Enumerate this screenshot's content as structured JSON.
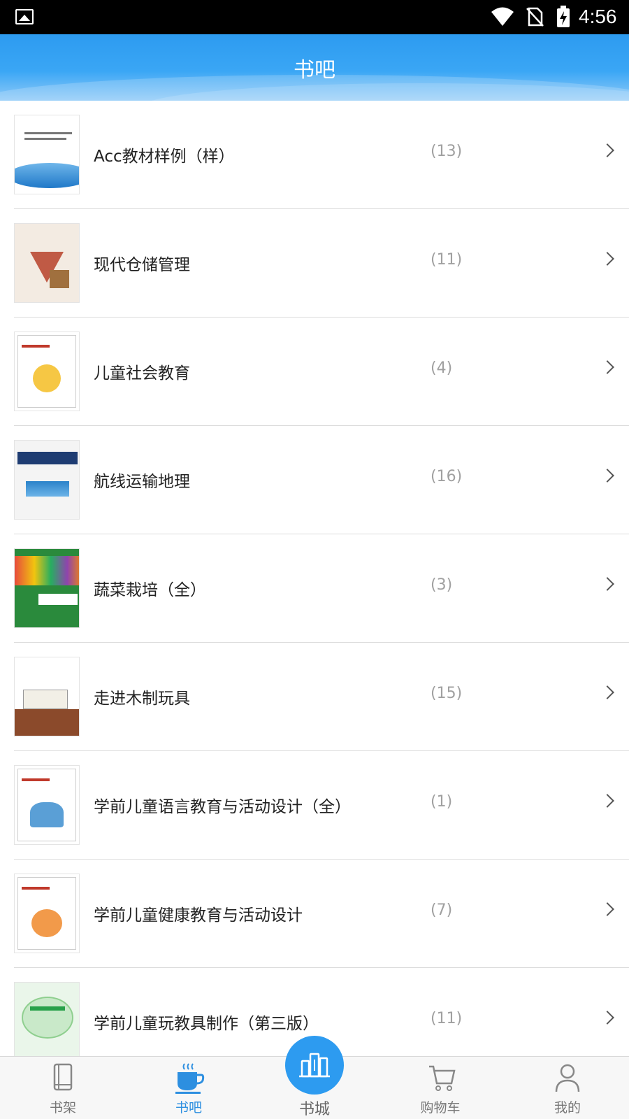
{
  "status_bar": {
    "time": "4:56",
    "icons": [
      "image-icon",
      "wifi-icon",
      "no-sim-icon",
      "battery-charging-icon"
    ]
  },
  "header": {
    "title": "书吧"
  },
  "books": [
    {
      "title": "Acc教材样例（样）",
      "count": "(13)"
    },
    {
      "title": "现代仓储管理",
      "count": "(11)"
    },
    {
      "title": "儿童社会教育",
      "count": "(4)"
    },
    {
      "title": "航线运输地理",
      "count": "(16)"
    },
    {
      "title": "蔬菜栽培（全）",
      "count": "(3)"
    },
    {
      "title": "走进木制玩具",
      "count": "(15)"
    },
    {
      "title": "学前儿童语言教育与活动设计（全）",
      "count": "(1)"
    },
    {
      "title": "学前儿童健康教育与活动设计",
      "count": "(7)"
    },
    {
      "title": "学前儿童玩教具制作（第三版）",
      "count": "(11)"
    }
  ],
  "tabbar": {
    "tabs": [
      {
        "label": "书架",
        "icon": "book-icon"
      },
      {
        "label": "书吧",
        "icon": "coffee-cup-icon",
        "active": true
      },
      {
        "label": "书城",
        "icon": "city-buildings-icon"
      },
      {
        "label": "购物车",
        "icon": "cart-icon"
      },
      {
        "label": "我的",
        "icon": "person-icon"
      }
    ]
  },
  "colors": {
    "accent": "#2d9bf0",
    "active_tab": "#2d8fe0",
    "count_gray": "#a0a0a0"
  }
}
